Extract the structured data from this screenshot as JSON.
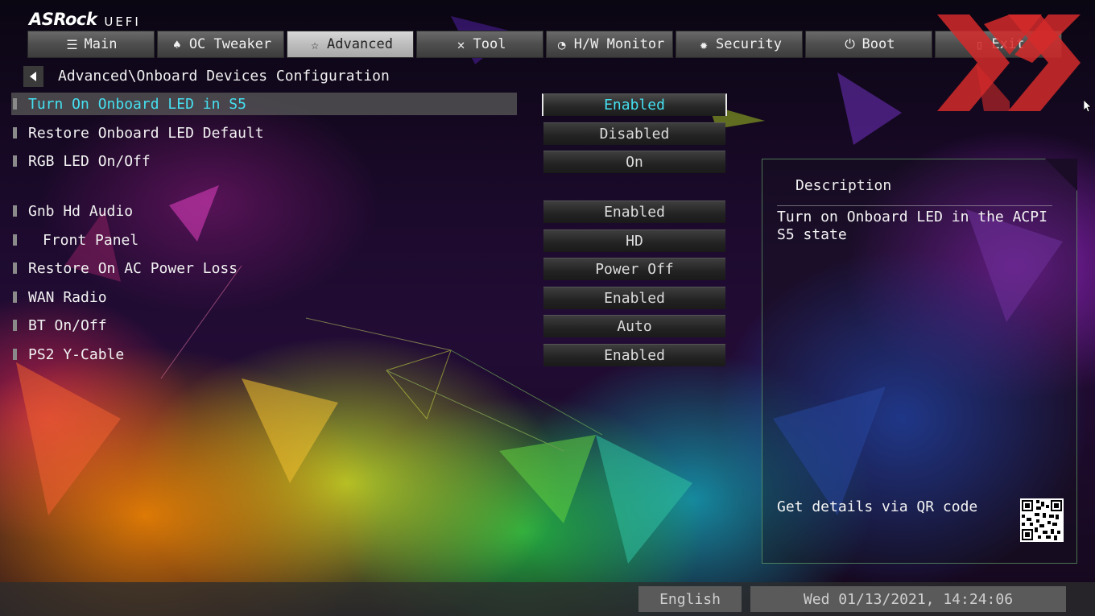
{
  "header": {
    "logo_main": "ASRock",
    "logo_sub": "UEFI",
    "tabs": [
      {
        "label": "Main",
        "icon": "list-icon"
      },
      {
        "label": "OC Tweaker",
        "icon": "rocket-icon"
      },
      {
        "label": "Advanced",
        "icon": "star-icon",
        "active": true
      },
      {
        "label": "Tool",
        "icon": "tools-icon"
      },
      {
        "label": "H/W Monitor",
        "icon": "gauge-icon"
      },
      {
        "label": "Security",
        "icon": "shield-icon"
      },
      {
        "label": "Boot",
        "icon": "power-icon"
      },
      {
        "label": "Exit",
        "icon": "exit-icon"
      }
    ]
  },
  "breadcrumb": "Advanced\\Onboard Devices Configuration",
  "settings": [
    {
      "label": "Turn On Onboard LED in S5",
      "value": "Enabled",
      "selected": true
    },
    {
      "label": "Restore Onboard LED Default",
      "value": "Disabled"
    },
    {
      "label": "RGB LED On/Off",
      "value": "On"
    },
    {
      "label": "Gnb Hd Audio",
      "value": "Enabled"
    },
    {
      "label": "Front Panel",
      "value": "HD"
    },
    {
      "label": "Restore On AC Power Loss",
      "value": "Power Off"
    },
    {
      "label": "WAN Radio",
      "value": "Enabled"
    },
    {
      "label": "BT On/Off",
      "value": "Auto"
    },
    {
      "label": "PS2 Y-Cable",
      "value": "Enabled"
    }
  ],
  "description": {
    "title": "Description",
    "text": "Turn on Onboard LED in the ACPI S5 state",
    "qr_label": "Get details via QR code"
  },
  "footer": {
    "language": "English",
    "datetime": "Wed 01/13/2021, 14:24:06"
  },
  "colors": {
    "selected_text": "#45e0f0",
    "watermark": "#d42a2a"
  }
}
